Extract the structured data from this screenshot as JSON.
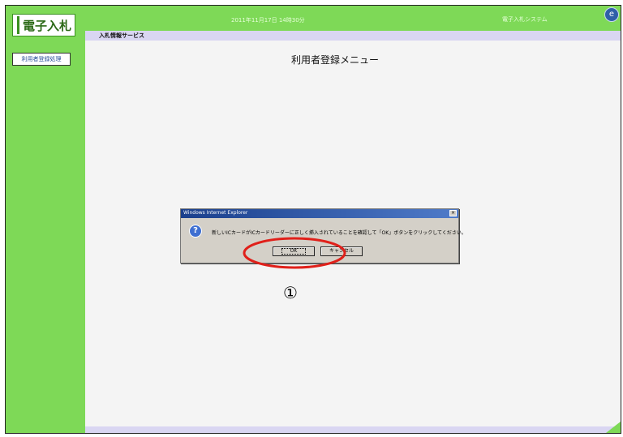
{
  "app": {
    "logo_text": "電子入札",
    "datetime": "2011年11月17日 14時30分",
    "system_name": "電子入札システム",
    "service_label": "入札情報サービス",
    "page_title": "利用者登録メニュー"
  },
  "sidebar": {
    "items": [
      {
        "label": "利用者登録処理"
      }
    ]
  },
  "dialog": {
    "title": "Windows Internet Explorer",
    "message": "新しいICカードがICカードリーダーに正しく挿入されていることを確認して「OK」ボタンをクリックしてください。",
    "ok_label": "OK",
    "cancel_label": "キャンセル",
    "close_glyph": "×"
  },
  "annotation": {
    "marker": "①",
    "highlight_color": "#e0201a"
  },
  "colors": {
    "green": "#7ed957",
    "lavender": "#d9d6f2",
    "dialog_gray": "#d4d0c8"
  },
  "icons": [
    "question-icon",
    "system-globe-icon",
    "close-icon"
  ]
}
